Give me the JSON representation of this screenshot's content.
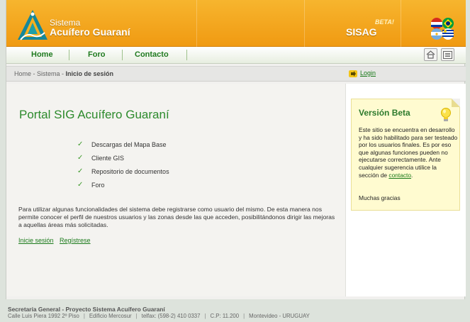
{
  "header": {
    "brand_top": "Sistema",
    "brand_main": "Acuífero Guaraní",
    "beta_tag": "BETA!",
    "app_name": "SISAG"
  },
  "nav": {
    "items": [
      "Home",
      "Foro",
      "Contacto"
    ],
    "icons": [
      "home-icon",
      "list-icon"
    ]
  },
  "breadcrumb": {
    "home": "Home",
    "section": "Sistema",
    "current": "Inicio de sesión",
    "sep": " - "
  },
  "login": {
    "label": "Login"
  },
  "main": {
    "title": "Portal SIG Acuífero Guaraní",
    "features": [
      "Descargas del Mapa Base",
      "Cliente GIS",
      "Repositorio de documentos",
      "Foro"
    ],
    "paragraph": "Para utilizar algunas funcionalidades del sistema debe registrarse como usuario del mismo. De esta manera nos permite conocer el perfil de nuestros usuarios y las zonas desde las que acceden, posibilitándonos dirigir las mejoras a aquellas áreas más solicitadas.",
    "login_link": "Inicie sesión",
    "register_link": "Regístrese"
  },
  "beta_box": {
    "title": "Versión Beta",
    "text": "Este sitio se encuentra en desarrollo y ha sido habilitado para ser testeado por los usuarios finales. Es por eso que algunas funciones pueden no ejecutarse correctamente. Ante cualquier sugerencia utilice la sección de",
    "link": "contacto",
    "after_link": ".",
    "thanks": "Muchas gracias"
  },
  "footer": {
    "line1": "Secretaría General - Proyecto Sistema Acuífero Guaraní",
    "address": "Calle Luis Piera 1992 2º Piso",
    "building": "Edificio Mercosur",
    "phone": "telfax: (598-2) 410 0337",
    "cp": "C.P: 11.200",
    "city": "Montevideo - URUGUAY"
  },
  "colors": {
    "header_orange": "#f09a12",
    "link_green": "#1a7a1a",
    "title_green": "#2c8a2c",
    "beta_bg": "#fffbd0"
  }
}
